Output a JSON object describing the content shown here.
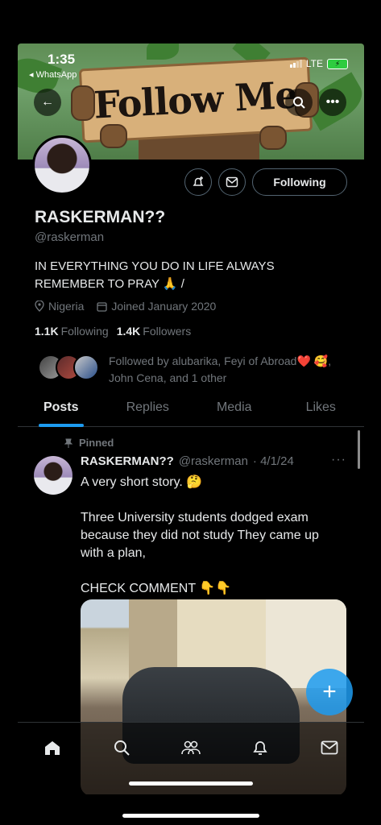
{
  "status_bar": {
    "time": "1:35",
    "back_app": "◂ WhatsApp",
    "network": "LTE"
  },
  "banner": {
    "sign_text": "Follow Me"
  },
  "profile": {
    "name": "RASKERMAN??",
    "handle": "@raskerman",
    "bio_line1": "IN EVERYTHING YOU DO IN LIFE ALWAYS",
    "bio_line2": "REMEMBER TO PRAY 🙏 /",
    "location": "Nigeria",
    "joined": "Joined January 2020",
    "following_count": "1.1K",
    "following_label": "Following",
    "followers_count": "1.4K",
    "followers_label": "Followers",
    "followed_by_line1": "Followed by alubarika, Feyi of Abroad❤️ 🥰,",
    "followed_by_line2": "John Cena, and 1 other",
    "follow_button": "Following"
  },
  "tabs": [
    {
      "label": "Posts",
      "active": true
    },
    {
      "label": "Replies",
      "active": false
    },
    {
      "label": "Media",
      "active": false
    },
    {
      "label": "Likes",
      "active": false
    }
  ],
  "post": {
    "pinned_label": "Pinned",
    "author_name": "RASKERMAN??",
    "author_handle": "@raskerman",
    "date": "· 4/1/24",
    "more": "···",
    "line1": "A very short story. 🤔",
    "paragraph2": "Three University students dodged exam because they did not study They came up with a plan,",
    "line3": "CHECK COMMENT 👇👇"
  },
  "colors": {
    "accent": "#1d9bf0",
    "background": "#000000",
    "text_primary": "#e7e9ea",
    "text_secondary": "#71767b"
  },
  "icons": {
    "back": "arrow-left-icon",
    "search": "search-icon",
    "more": "more-icon",
    "notify": "bell-plus-icon",
    "message": "envelope-icon",
    "fab": "plus-icon"
  },
  "nav": [
    "home-icon",
    "search-icon",
    "communities-icon",
    "notifications-icon",
    "messages-icon"
  ]
}
